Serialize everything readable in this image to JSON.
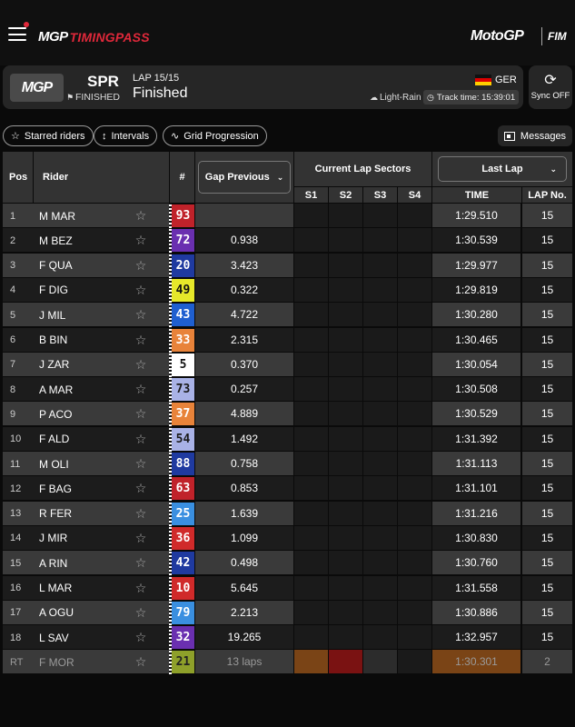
{
  "app": {
    "brand_mgp": "MGP",
    "brand_name": "TIMINGPASS",
    "motogp_logo": "MotoGP",
    "fim_logo": "FIM"
  },
  "session": {
    "badge": "MGP",
    "type": "SPR",
    "status": "FINISHED",
    "lap_info": "LAP 15/15",
    "lap_state": "Finished",
    "country": "GER",
    "weather": "Light-Rain",
    "track_time": "Track time: 15:39:01"
  },
  "sync": {
    "label": "Sync OFF"
  },
  "filters": {
    "starred": "Starred riders",
    "intervals": "Intervals",
    "grid": "Grid Progression",
    "messages": "Messages"
  },
  "table": {
    "headers": {
      "pos": "Pos",
      "rider": "Rider",
      "num": "#",
      "gap": "Gap Previous",
      "sectors": "Current Lap Sectors",
      "s1": "S1",
      "s2": "S2",
      "s3": "S3",
      "s4": "S4",
      "last_lap": "Last Lap",
      "time": "TIME",
      "lap_no": "LAP No."
    },
    "rows": [
      {
        "pos": "1",
        "rider": "M MAR",
        "num": "93",
        "color": "#c0222a",
        "text": "#ffffff",
        "gap": "",
        "time": "1:29.510",
        "lap": "15"
      },
      {
        "pos": "2",
        "rider": "M BEZ",
        "num": "72",
        "color": "#6a2fb0",
        "text": "#ffffff",
        "gap": "0.938",
        "time": "1:30.539",
        "lap": "15"
      },
      {
        "pos": "3",
        "rider": "F QUA",
        "num": "20",
        "color": "#1f3aa0",
        "text": "#ffffff",
        "gap": "3.423",
        "time": "1:29.977",
        "lap": "15"
      },
      {
        "pos": "4",
        "rider": "F DIG",
        "num": "49",
        "color": "#e6e82a",
        "text": "#111111",
        "gap": "0.322",
        "time": "1:29.819",
        "lap": "15"
      },
      {
        "pos": "5",
        "rider": "J MIL",
        "num": "43",
        "color": "#1f5fd0",
        "text": "#ffffff",
        "gap": "4.722",
        "time": "1:30.280",
        "lap": "15"
      },
      {
        "pos": "6",
        "rider": "B BIN",
        "num": "33",
        "color": "#e8833a",
        "text": "#ffffff",
        "gap": "2.315",
        "time": "1:30.465",
        "lap": "15"
      },
      {
        "pos": "7",
        "rider": "J ZAR",
        "num": "5",
        "color": "#ffffff",
        "text": "#111111",
        "gap": "0.370",
        "time": "1:30.054",
        "lap": "15"
      },
      {
        "pos": "8",
        "rider": "A MAR",
        "num": "73",
        "color": "#a9b2e6",
        "text": "#1a1a1a",
        "gap": "0.257",
        "time": "1:30.508",
        "lap": "15"
      },
      {
        "pos": "9",
        "rider": "P ACO",
        "num": "37",
        "color": "#e8833a",
        "text": "#ffffff",
        "gap": "4.889",
        "time": "1:30.529",
        "lap": "15"
      },
      {
        "pos": "10",
        "rider": "F ALD",
        "num": "54",
        "color": "#a9b2e6",
        "text": "#1a1a1a",
        "gap": "1.492",
        "time": "1:31.392",
        "lap": "15"
      },
      {
        "pos": "11",
        "rider": "M OLI",
        "num": "88",
        "color": "#1f3aa0",
        "text": "#ffffff",
        "gap": "0.758",
        "time": "1:31.113",
        "lap": "15"
      },
      {
        "pos": "12",
        "rider": "F BAG",
        "num": "63",
        "color": "#c0222a",
        "text": "#ffffff",
        "gap": "0.853",
        "time": "1:31.101",
        "lap": "15"
      },
      {
        "pos": "13",
        "rider": "R FER",
        "num": "25",
        "color": "#3a8fe0",
        "text": "#ffffff",
        "gap": "1.639",
        "time": "1:31.216",
        "lap": "15"
      },
      {
        "pos": "14",
        "rider": "J MIR",
        "num": "36",
        "color": "#d02a2a",
        "text": "#ffffff",
        "gap": "1.099",
        "time": "1:30.830",
        "lap": "15"
      },
      {
        "pos": "15",
        "rider": "A RIN",
        "num": "42",
        "color": "#1f3aa0",
        "text": "#ffffff",
        "gap": "0.498",
        "time": "1:30.760",
        "lap": "15"
      },
      {
        "pos": "16",
        "rider": "L MAR",
        "num": "10",
        "color": "#d02a2a",
        "text": "#ffffff",
        "gap": "5.645",
        "time": "1:31.558",
        "lap": "15"
      },
      {
        "pos": "17",
        "rider": "A OGU",
        "num": "79",
        "color": "#3a8fe0",
        "text": "#ffffff",
        "gap": "2.213",
        "time": "1:30.886",
        "lap": "15"
      },
      {
        "pos": "18",
        "rider": "L SAV",
        "num": "32",
        "color": "#6a2fb0",
        "text": "#ffffff",
        "gap": "19.265",
        "time": "1:32.957",
        "lap": "15"
      },
      {
        "pos": "RT",
        "rider": "F MOR",
        "num": "21",
        "color": "#8ea02a",
        "text": "#222222",
        "gap": "13 laps",
        "time": "1:30.301",
        "lap": "2",
        "retired": true
      }
    ]
  },
  "colors": {
    "accent": "#e0283a",
    "row_light": "#3a3a3a",
    "row_dark": "#1c1c1c",
    "sector_orange": "#7a4416",
    "sector_red": "#7a1212"
  },
  "icons": {
    "menu": "hamburger-icon",
    "star": "star-outline-icon",
    "sync": "sync-icon",
    "messages": "messages-icon"
  }
}
